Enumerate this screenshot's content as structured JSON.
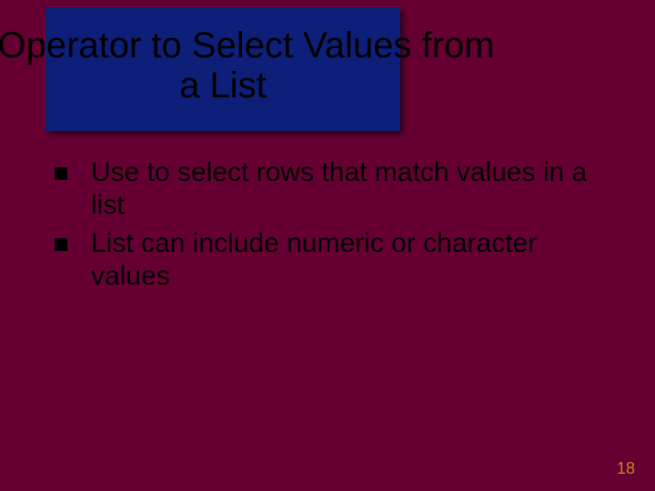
{
  "slide": {
    "title": "IN Operator to Select Values from a List",
    "bullets": [
      "Use to select rows that match values in a list",
      "List can include numeric or character values"
    ],
    "pageNumber": "18"
  }
}
